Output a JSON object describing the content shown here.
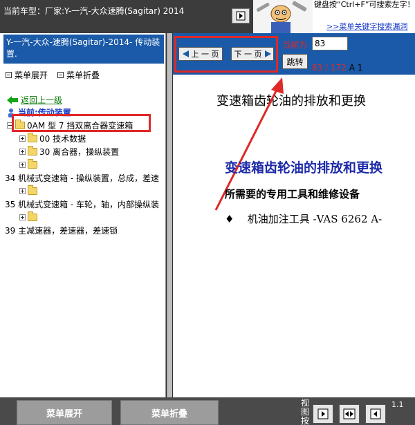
{
  "header": {
    "car_label": "当前车型：厂家:Y-一汽-大众速腾(Sagitar) 2014",
    "hint_text": "键盘按“Ctrl+F”可搜索左字！",
    "hint_link": ">>菜单关键字搜索漏洞"
  },
  "sidebar": {
    "model_title": "Y-一汽-大众-速腾(Sagitar)-2014- 传动装置.",
    "expand_label": "菜单展开",
    "collapse_label": "菜单折叠",
    "back_label": "返回上一级",
    "current_label": "当前:传动装置",
    "tree": [
      {
        "label": "0AM 型 7 挡双离合器变速箱"
      },
      {
        "label": "00 技术数据"
      },
      {
        "label": "30 离合器，操纵装置"
      },
      {
        "label": ""
      },
      {
        "label": "34 机械式变速箱 - 操纵装置，总成，差速"
      },
      {
        "label": ""
      },
      {
        "label": "35 机械式变速箱 - 车轮，轴，内部操纵装"
      },
      {
        "label": ""
      },
      {
        "label": "39 主减速器，差速器，差速锁"
      }
    ]
  },
  "pager": {
    "prev_label": "上 一 页",
    "next_label": "下 一 页",
    "current_label": "当前为",
    "page_value": "83",
    "jump_label": "跳转",
    "current_page": "83",
    "separator": "/",
    "total_pages": "172",
    "suffix": "A 1"
  },
  "document": {
    "heading": "变速箱齿轮油的排放和更换",
    "title": "变速箱齿轮油的排放和更换",
    "tools_heading": "所需要的专用工具和维修设备",
    "bullet": "♦",
    "tool_item": "机油加注工具 -VAS 6262 A-"
  },
  "bottom": {
    "expand_label": "菜单展开",
    "collapse_label": "菜单折叠",
    "view_label": "视图按",
    "view_number": "1.1"
  },
  "colors": {
    "panel_blue": "#1a5aa8",
    "highlight_red": "#e02828",
    "title_blue": "#1d2aa8"
  }
}
